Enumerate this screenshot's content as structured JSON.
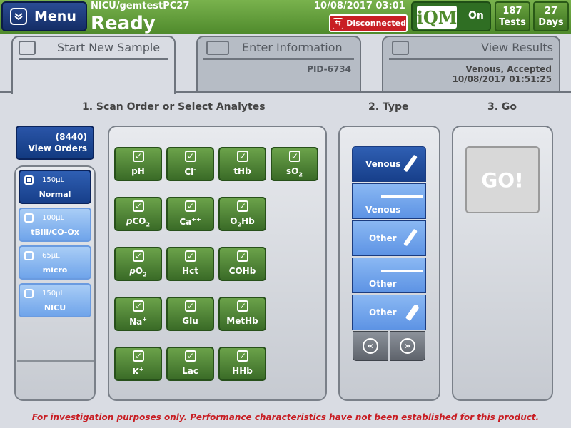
{
  "header": {
    "menu_label": "Menu",
    "device": "NICU/gemtestPC27",
    "status": "Ready",
    "datetime": "10/08/2017 03:01",
    "connection": "Disconnected",
    "iqm_logo": "iQM",
    "iqm_state": "On",
    "tests_count": "187",
    "tests_label": "Tests",
    "days_count": "27",
    "days_label": "Days",
    "colors": {
      "header_green": "#5f9b38",
      "disconnected_red": "#c81e24",
      "navy": "#173f8a"
    }
  },
  "tabs": {
    "start": "Start New Sample",
    "enter": "Enter Information",
    "enter_sub": "PID-6734",
    "results": "View Results",
    "results_sub1": "Venous, Accepted",
    "results_sub2": "10/08/2017 01:51:25"
  },
  "steps": {
    "scan": "1. Scan Order or Select Analytes",
    "type": "2. Type",
    "go": "3. Go"
  },
  "orders": {
    "count": "(8440)",
    "label": "View Orders"
  },
  "volumes": [
    {
      "vol": "150µL",
      "name": "Normal",
      "selected": true
    },
    {
      "vol": "100µL",
      "name": "tBili/CO-Ox",
      "selected": false
    },
    {
      "vol": "65µL",
      "name": "micro",
      "selected": false
    },
    {
      "vol": "150µL",
      "name": "NICU",
      "selected": false
    }
  ],
  "analytes": {
    "check": "✓",
    "pH": "pH",
    "cl": "Cl",
    "cl_sup": "-",
    "thb": "tHb",
    "so2": "sO",
    "so2_sub": "2",
    "pco2_p": "p",
    "pco2": "CO",
    "pco2_sub": "2",
    "ca": "Ca",
    "ca_sup": "++",
    "o2hb_a": "O",
    "o2hb_sub": "2",
    "o2hb_b": "Hb",
    "po2_p": "p",
    "po2": "O",
    "po2_sub": "2",
    "hct": "Hct",
    "cohb": "COHb",
    "na": "Na",
    "na_sup": "+",
    "glu": "Glu",
    "methb": "MetHb",
    "k": "K",
    "k_sup": "+",
    "lac": "Lac",
    "hhb": "HHb"
  },
  "types": [
    {
      "label": "Venous",
      "icon": "syringe-icon",
      "selected": true
    },
    {
      "label": "Venous",
      "icon": "capillary-line-icon",
      "selected": false
    },
    {
      "label": "Other",
      "icon": "syringe-icon",
      "selected": false
    },
    {
      "label": "Other",
      "icon": "capillary-line-icon",
      "selected": false
    },
    {
      "label": "Other",
      "icon": "ampule-icon",
      "selected": false
    }
  ],
  "nav": {
    "prev": "«",
    "next": "»"
  },
  "go_label": "GO!",
  "disclaimer": "For investigation purposes only.  Performance characteristics have not been established for this product."
}
